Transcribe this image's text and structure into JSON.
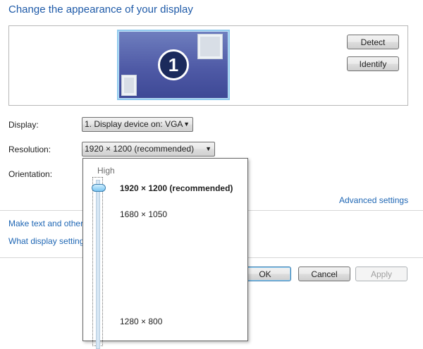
{
  "page": {
    "title": "Change the appearance of your display"
  },
  "preview": {
    "monitor_number": "1"
  },
  "buttons": {
    "detect": "Detect",
    "identify": "Identify",
    "ok": "OK",
    "cancel": "Cancel",
    "apply": "Apply"
  },
  "fields": {
    "display": {
      "label": "Display:",
      "value": "1. Display device on: VGA"
    },
    "resolution": {
      "label": "Resolution:",
      "value": "1920 × 1200 (recommended)"
    },
    "orientation": {
      "label": "Orientation:"
    }
  },
  "links": {
    "advanced_settings": "Advanced settings",
    "make_text": "Make text and other",
    "what_display": "What display setting"
  },
  "resolution_dropdown": {
    "high_label": "High",
    "options": [
      "1920 × 1200 (recommended)",
      "1680 × 1050",
      "1280 × 800"
    ],
    "selected_index": 0
  }
}
